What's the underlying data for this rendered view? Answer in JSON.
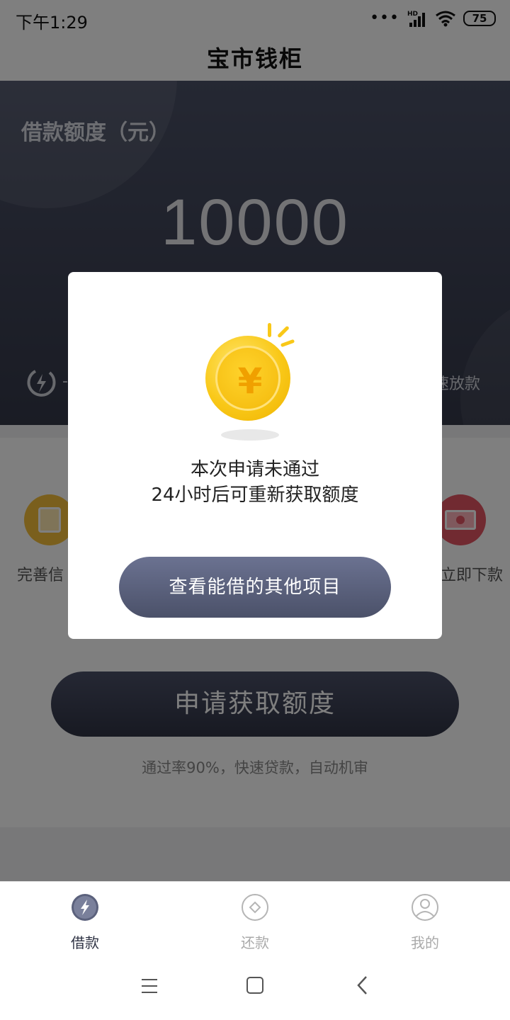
{
  "status_bar": {
    "time": "下午1:29",
    "signal_dots": "•••",
    "network": "HD",
    "battery": "75"
  },
  "header": {
    "title": "宝市钱柜"
  },
  "hero": {
    "label": "借款额度（元）",
    "amount": "10000",
    "bottom_left_text": "-",
    "bottom_right_text": "速放款"
  },
  "features": {
    "left_label": "完善信",
    "right_label": "立即下款"
  },
  "apply": {
    "button_label": "申请获取额度",
    "note": "通过率90%，快速贷款，自动机审"
  },
  "dialog": {
    "coin_symbol": "¥",
    "line1": "本次申请未通过",
    "line2": "24小时后可重新获取额度",
    "button_label": "查看能借的其他项目"
  },
  "tabbar": {
    "items": [
      {
        "label": "借款",
        "icon": "lightning-icon",
        "active": true
      },
      {
        "label": "还款",
        "icon": "diamond-circle-icon",
        "active": false
      },
      {
        "label": "我的",
        "icon": "user-icon",
        "active": false
      }
    ]
  },
  "colors": {
    "primary_dark": "#343849",
    "dialog_button": "#5b617c",
    "coin_gold": "#f9c818",
    "feature_yellow": "#f5bf3a",
    "feature_red": "#e35462"
  }
}
